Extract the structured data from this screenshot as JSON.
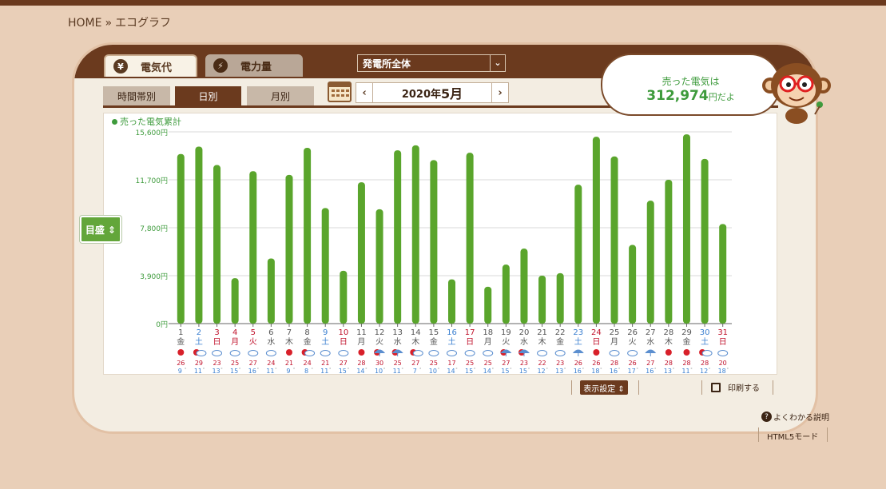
{
  "breadcrumb": {
    "home": "HOME",
    "separator": "»",
    "current": "エコグラフ"
  },
  "tabs": {
    "cost_label": "電気代",
    "cost_icon": "yen-icon",
    "power_label": "電力量",
    "power_icon": "bolt-icon"
  },
  "plant_select": {
    "value": "発電所全体"
  },
  "subtabs": {
    "hourly": "時間帯別",
    "daily": "日別",
    "monthly": "月別"
  },
  "month_nav": {
    "prev": "‹",
    "next": "›",
    "year_text": "2020年",
    "month_text": "5月"
  },
  "bubble": {
    "line1": "売った電気は",
    "amount": "312,974",
    "suffix": "円だよ"
  },
  "scale_button": "目盛 ⇕",
  "display_settings": "表示設定 ⇕",
  "print_label": "印刷する",
  "help_label": "よくわかる説明",
  "html5_label": "HTML5モード",
  "colors": {
    "bar": "#5aa52c",
    "weekday_text": "#555555",
    "saturday_text": "#3a7fd0",
    "sunday_text": "#c0102a",
    "high_temp": "#c0102a",
    "low_temp": "#3a7fd0",
    "brown": "#6b3a1e"
  },
  "chart_data": {
    "type": "bar",
    "legend": "売った電気累計",
    "y_tick_labels": [
      "15,600円",
      "11,700円",
      "7,800円",
      "3,900円",
      "0円"
    ],
    "y_ticks": [
      15600,
      11700,
      7800,
      3900,
      0
    ],
    "ylim": [
      0,
      15600
    ],
    "grid": true,
    "days": [
      "1",
      "2",
      "3",
      "4",
      "5",
      "6",
      "7",
      "8",
      "9",
      "10",
      "11",
      "12",
      "13",
      "14",
      "15",
      "16",
      "17",
      "18",
      "19",
      "20",
      "21",
      "22",
      "23",
      "24",
      "25",
      "26",
      "27",
      "28",
      "29",
      "30",
      "31"
    ],
    "weekdays": [
      "金",
      "土",
      "日",
      "月",
      "火",
      "水",
      "木",
      "金",
      "土",
      "日",
      "月",
      "火",
      "水",
      "木",
      "金",
      "土",
      "日",
      "月",
      "火",
      "水",
      "木",
      "金",
      "土",
      "日",
      "月",
      "火",
      "水",
      "木",
      "金",
      "土",
      "日"
    ],
    "day_types": [
      "w",
      "sat",
      "hol",
      "hol",
      "hol",
      "w",
      "w",
      "w",
      "sat",
      "sun",
      "w",
      "w",
      "w",
      "w",
      "w",
      "sat",
      "sun",
      "w",
      "w",
      "w",
      "w",
      "w",
      "sat",
      "sun",
      "w",
      "w",
      "w",
      "w",
      "w",
      "sat",
      "sun"
    ],
    "values": [
      13800,
      14400,
      12900,
      3700,
      12400,
      5300,
      12100,
      14300,
      9400,
      4300,
      11500,
      9300,
      14100,
      14500,
      13300,
      3600,
      13900,
      3000,
      4800,
      6100,
      3900,
      4100,
      11300,
      15200,
      13600,
      6400,
      10000,
      11700,
      15400,
      13400,
      8100
    ],
    "weather": [
      "sun",
      "sun-cloud",
      "cloud",
      "cloud",
      "cloud",
      "cloud",
      "sun",
      "sun-cloud",
      "cloud",
      "cloud",
      "sun",
      "sun-rain",
      "sun-rain",
      "sun-cloud",
      "cloud",
      "cloud",
      "cloud",
      "cloud",
      "sun-rain",
      "sun-rain",
      "cloud",
      "cloud",
      "rain",
      "sun",
      "cloud",
      "cloud",
      "rain",
      "sun",
      "sun",
      "sun-cloud",
      "cloud"
    ],
    "high_temps": [
      "26",
      "29",
      "23",
      "25",
      "27",
      "24",
      "21",
      "24",
      "21",
      "27",
      "28",
      "30",
      "25",
      "27",
      "25",
      "17",
      "25",
      "25",
      "27",
      "23",
      "22",
      "23",
      "26",
      "26",
      "28",
      "26",
      "27",
      "28",
      "28",
      "28",
      "20"
    ],
    "low_temps": [
      "9",
      "11",
      "13",
      "15",
      "16",
      "11",
      "9",
      "8",
      "11",
      "15",
      "14",
      "10",
      "11",
      "7",
      "10",
      "14",
      "15",
      "14",
      "15",
      "15",
      "12",
      "13",
      "16",
      "18",
      "16",
      "17",
      "16",
      "13",
      "11",
      "12",
      "18"
    ]
  }
}
